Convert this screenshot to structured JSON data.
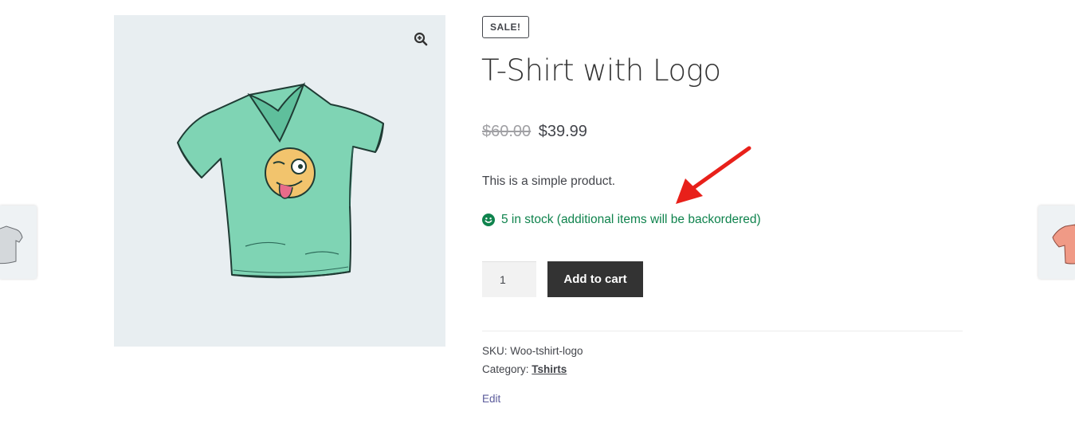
{
  "product": {
    "sale_badge": "SALE!",
    "title": "T-Shirt with Logo",
    "price_old": "$60.00",
    "price_new": "$39.99",
    "short_description": "This is a simple product.",
    "stock_text": "5 in stock (additional items will be backordered)",
    "quantity": "1",
    "add_to_cart_label": "Add to cart",
    "sku_label": "SKU:",
    "sku_value": "Woo-tshirt-logo",
    "category_label": "Category:",
    "category_value": "Tshirts",
    "edit_label": "Edit"
  },
  "colors": {
    "stock_green": "#0f834d",
    "button_bg": "#333333",
    "annotation_arrow": "#e8201a",
    "gallery_bg": "#e8eef1",
    "shirt_green": "#7fd4b4",
    "prev_shirt_color": "#cfd3d6",
    "next_shirt_color": "#f09a86"
  },
  "icons": {
    "zoom": "zoom-in-icon",
    "stock": "smiley-icon",
    "annotation": "red-arrow-annotation"
  }
}
